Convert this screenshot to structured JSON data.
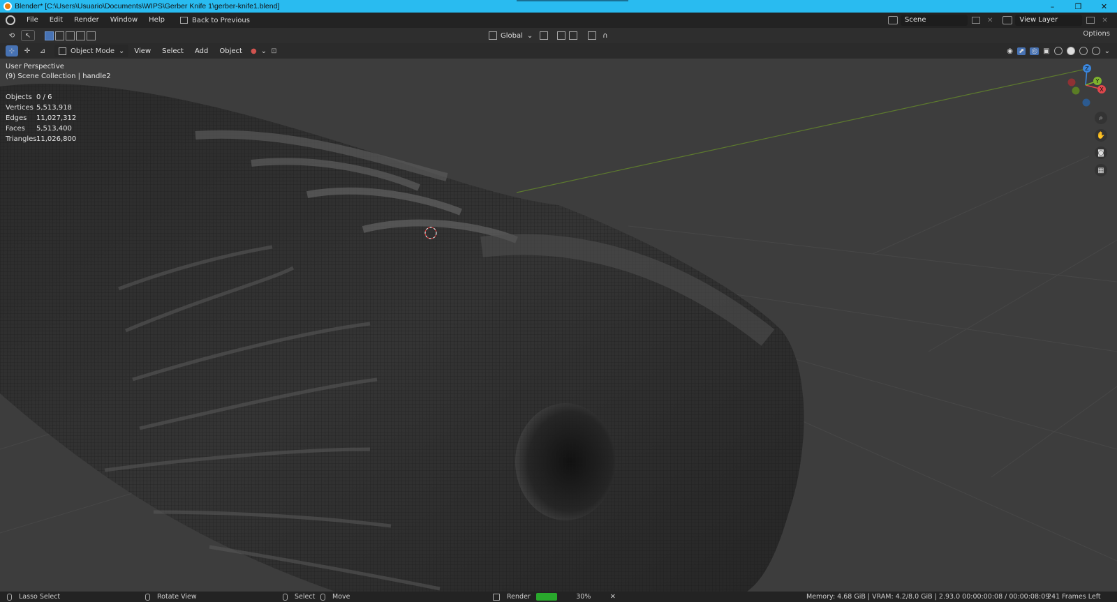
{
  "window": {
    "title": "Blender* [C:\\Users\\Usuario\\Documents\\WIPS\\Gerber Knife 1\\gerber-knife1.blend]",
    "minimize": "–",
    "maximize": "❐",
    "close": "✕"
  },
  "menu": {
    "items": [
      "File",
      "Edit",
      "Render",
      "Window",
      "Help"
    ],
    "back": "Back to Previous"
  },
  "scene": {
    "name": "Scene",
    "view_layer": "View Layer"
  },
  "tool_header": {
    "orientation": "Global",
    "options": "Options"
  },
  "viewport_header": {
    "mode": "Object Mode",
    "menus": [
      "View",
      "Select",
      "Add",
      "Object"
    ]
  },
  "viewport": {
    "perspective": "User Perspective",
    "collection": "(9) Scene Collection | handle2",
    "stats": [
      {
        "label": "Objects",
        "value": "0 / 6"
      },
      {
        "label": "Vertices",
        "value": "5,513,918"
      },
      {
        "label": "Edges",
        "value": "11,027,312"
      },
      {
        "label": "Faces",
        "value": "5,513,400"
      },
      {
        "label": "Triangles",
        "value": "11,026,800"
      }
    ],
    "gizmo": {
      "x": "X",
      "y": "Y",
      "z": "Z"
    }
  },
  "colors": {
    "axis_x": "#e0474c",
    "axis_y": "#7fb32e",
    "axis_z": "#3b86dc",
    "accent": "#4772b3",
    "render_progress": "#29a82c"
  },
  "statusbar": {
    "lasso": "Lasso Select",
    "rotate": "Rotate View",
    "select": "Select",
    "move": "Move",
    "render": "Render",
    "render_percent": "30%",
    "render_progress": 0.3,
    "cancel": "✕",
    "info": "Memory: 4.68 GiB | VRAM: 4.2/8.0 GiB | 2.93.0   00:00:00:08 / 00:00:08:09",
    "frames_left": "241 Frames Left"
  }
}
